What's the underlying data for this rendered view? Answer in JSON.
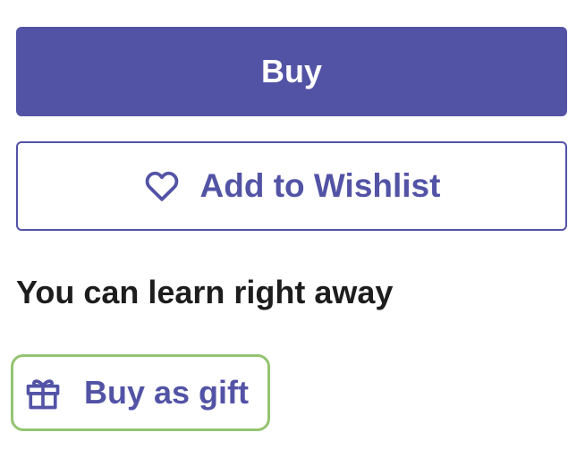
{
  "actions": {
    "buy_label": "Buy",
    "wishlist_label": "Add to Wishlist",
    "gift_label": "Buy as gift"
  },
  "info": {
    "headline": "You can learn right away"
  },
  "icons": {
    "wishlist": "heart-icon",
    "gift": "gift-icon"
  },
  "colors": {
    "primary": "#5353a6",
    "focus_ring": "#94c471",
    "text": "#1d1d1d"
  }
}
